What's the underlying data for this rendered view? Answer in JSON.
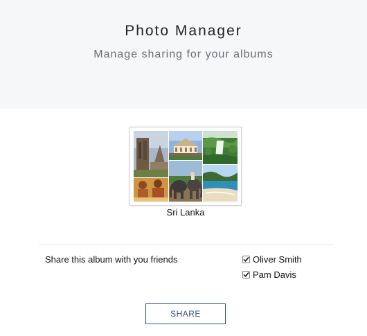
{
  "header": {
    "title": "Photo Manager",
    "subtitle": "Manage sharing for your albums"
  },
  "album": {
    "name": "Sri Lanka",
    "thumbnail_icon": "photo-collage-icon"
  },
  "share": {
    "label": "Share this album with you friends",
    "friends": [
      {
        "name": "Oliver Smith",
        "checked": true
      },
      {
        "name": "Pam Davis",
        "checked": true
      }
    ],
    "button_label": "SHARE"
  },
  "colors": {
    "header_bg": "#f6f7f9",
    "button_accent": "#3b4b8c"
  }
}
